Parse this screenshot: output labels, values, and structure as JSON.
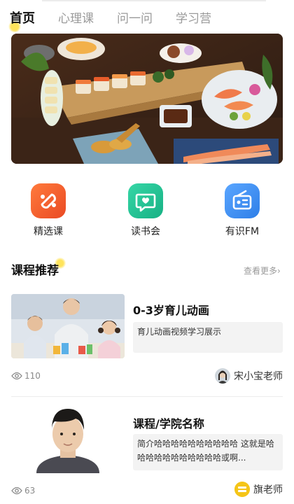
{
  "tabs": [
    {
      "label": "首页",
      "active": true
    },
    {
      "label": "心理课",
      "active": false
    },
    {
      "label": "问一问",
      "active": false
    },
    {
      "label": "学习营",
      "active": false
    }
  ],
  "banner": {
    "image": "sushi-food-photo"
  },
  "quick_links": [
    {
      "label": "精选课",
      "icon": "featured-course-icon",
      "color": "#f0582c"
    },
    {
      "label": "读书会",
      "icon": "book-club-chat-icon",
      "color": "#23c296"
    },
    {
      "label": "有识FM",
      "icon": "radio-fm-icon",
      "color": "#3c8ef0"
    }
  ],
  "section": {
    "title": "课程推荐",
    "more": "查看更多›"
  },
  "courses": [
    {
      "title": "0-3岁育儿动画",
      "description": "育儿动画视频学习展示",
      "views": "110",
      "teacher": "宋小宝老师"
    },
    {
      "title": "课程/学院名称",
      "description": "简介哈哈哈哈哈哈哈哈哈哈 这就是哈哈哈哈哈哈哈哈哈哈哈或啊...",
      "views": "63",
      "teacher": "旗老师",
      "teacher_badge": "有识 蛋糕"
    }
  ],
  "colors": {
    "accent_yellow": "#ffe45c",
    "text_muted": "#9a9a9a"
  }
}
